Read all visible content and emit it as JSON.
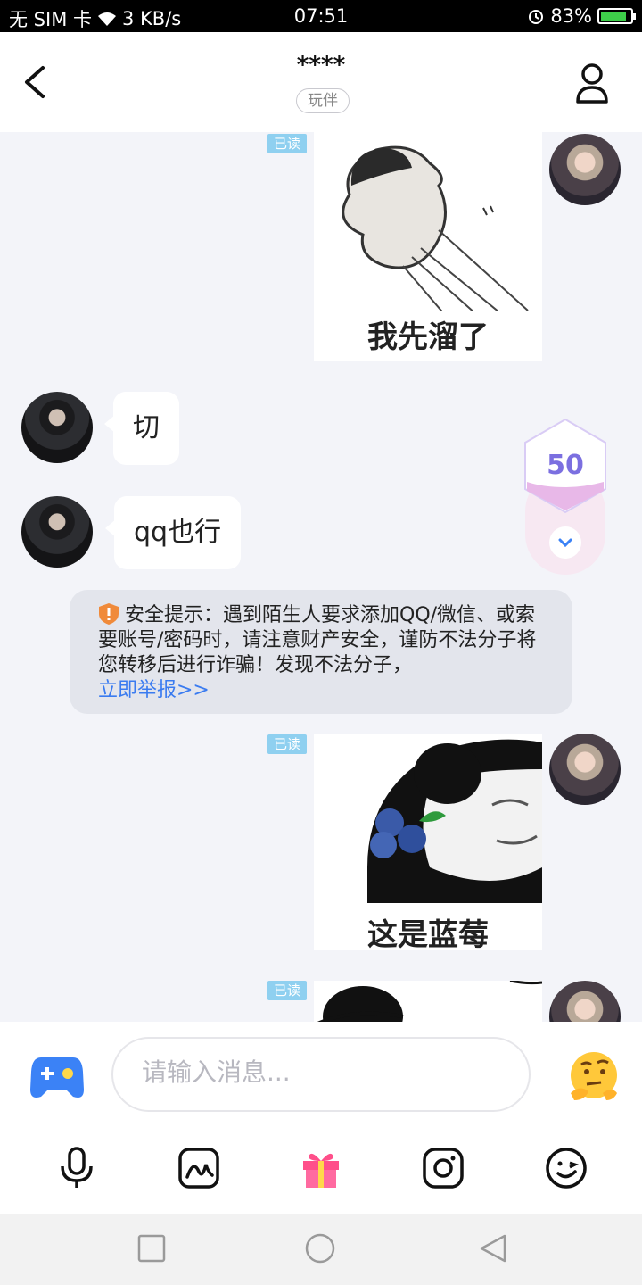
{
  "status_bar": {
    "carrier": "无 SIM 卡",
    "speed": "3 KB/s",
    "time": "07:51",
    "battery": "83%"
  },
  "header": {
    "title": "****",
    "tag": "玩伴"
  },
  "messages": {
    "read_label": "已读",
    "sticker1_caption": "我先溜了",
    "reply1": "切",
    "reply2": "qq也行",
    "sticker2_caption": "这是蓝莓"
  },
  "security_notice": {
    "text": "安全提示：遇到陌生人要求添加QQ/微信、或索要账号/密码时，请注意财产安全，谨防不法分子将您转移后进行诈骗！发现不法分子，",
    "link": "立即举报>>"
  },
  "floating_counter": {
    "value": "50"
  },
  "input": {
    "placeholder": "请输入消息..."
  },
  "icons": {
    "accent_blue": "#3b82f6",
    "gift_color": "#ff4f8a",
    "counter_color": "#7b6fe0"
  }
}
